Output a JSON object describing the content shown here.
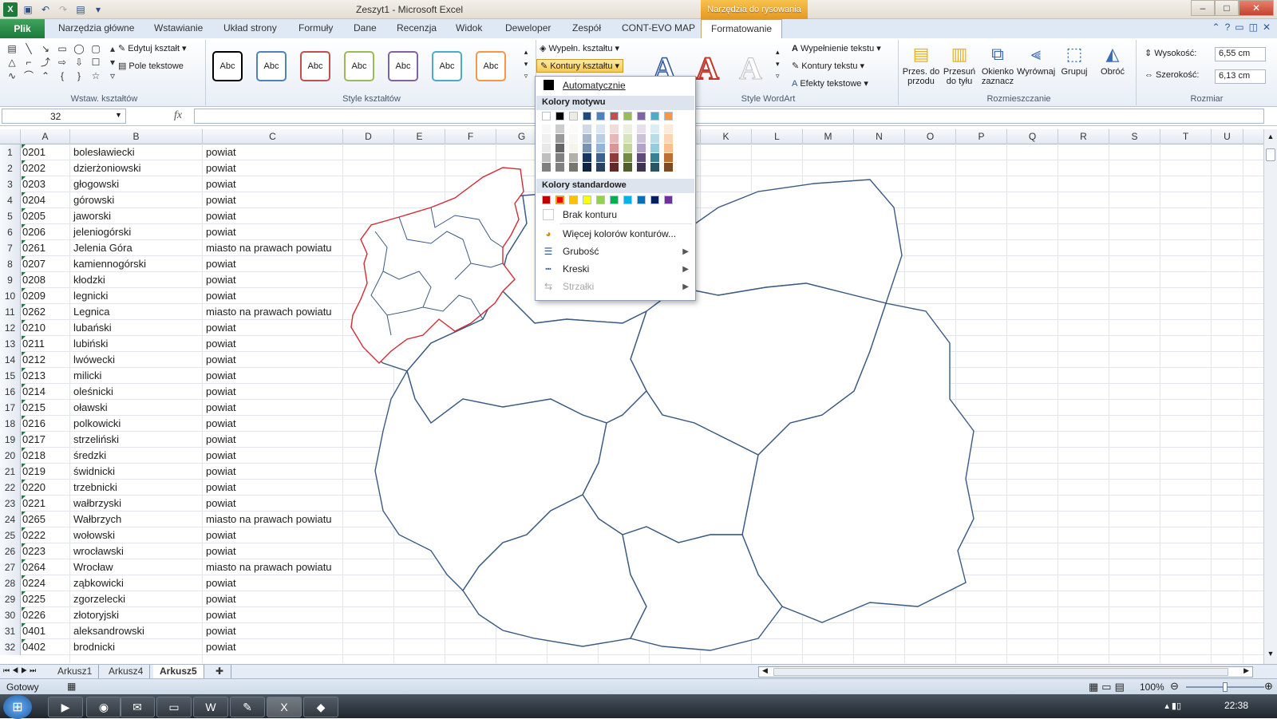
{
  "window": {
    "title": "Zeszyt1  -  Microsoft Excel",
    "context_header": "Narzędzia do rysowania"
  },
  "tabs": [
    "Plik",
    "Narzędzia główne",
    "Wstawianie",
    "Układ strony",
    "Formuły",
    "Dane",
    "Recenzja",
    "Widok",
    "Deweloper",
    "Zespół",
    "CONT-EVO MAP",
    "Formatowanie"
  ],
  "ribbon": {
    "insert_shapes": {
      "label": "Wstaw. kształtów",
      "edit_shape": "Edytuj kształt",
      "text_box": "Pole tekstowe"
    },
    "shape_styles": {
      "label": "Style kształtów",
      "sample": "Abc",
      "fill": "Wypełn. kształtu",
      "outline": "Kontury kształtu"
    },
    "wordart": {
      "label": "Style WordArt",
      "letter": "A",
      "text_fill": "Wypełnienie tekstu",
      "text_outline": "Kontury tekstu",
      "text_effects": "Efekty tekstowe"
    },
    "arrange": {
      "label": "Rozmieszczanie",
      "bring_forward": "Przes. do przodu",
      "send_backward": "Przesuń do tyłu",
      "selection_pane": "Okienko zaznacz",
      "align": "Wyrównaj",
      "group": "Grupuj",
      "rotate": "Obróć"
    },
    "size": {
      "label": "Rozmiar",
      "height_label": "Wysokość:",
      "height": "6,55 cm",
      "width_label": "Szerokość:",
      "width": "6,13 cm"
    }
  },
  "formula_bar": {
    "name_box": "32",
    "fx": "fx",
    "formula": ""
  },
  "columns": [
    "A",
    "B",
    "C",
    "D",
    "E",
    "F",
    "G",
    "H",
    "I",
    "J",
    "K",
    "L",
    "M",
    "N",
    "O",
    "P",
    "Q",
    "R",
    "S",
    "T",
    "U"
  ],
  "rows": [
    {
      "n": "1",
      "a": "0201",
      "b": "bolesławiecki",
      "c": "powiat"
    },
    {
      "n": "2",
      "a": "0202",
      "b": "dzierżoniowski",
      "c": "powiat"
    },
    {
      "n": "3",
      "a": "0203",
      "b": "głogowski",
      "c": "powiat"
    },
    {
      "n": "4",
      "a": "0204",
      "b": "górowski",
      "c": "powiat"
    },
    {
      "n": "5",
      "a": "0205",
      "b": "jaworski",
      "c": "powiat"
    },
    {
      "n": "6",
      "a": "0206",
      "b": "jeleniogórski",
      "c": "powiat"
    },
    {
      "n": "7",
      "a": "0261",
      "b": "Jelenia Góra",
      "c": "miasto na prawach powiatu"
    },
    {
      "n": "8",
      "a": "0207",
      "b": "kamiennogórski",
      "c": "powiat"
    },
    {
      "n": "9",
      "a": "0208",
      "b": "kłodzki",
      "c": "powiat"
    },
    {
      "n": "10",
      "a": "0209",
      "b": "legnicki",
      "c": "powiat"
    },
    {
      "n": "11",
      "a": "0262",
      "b": "Legnica",
      "c": "miasto na prawach powiatu"
    },
    {
      "n": "12",
      "a": "0210",
      "b": "lubański",
      "c": "powiat"
    },
    {
      "n": "13",
      "a": "0211",
      "b": "lubiński",
      "c": "powiat"
    },
    {
      "n": "14",
      "a": "0212",
      "b": "lwówecki",
      "c": "powiat"
    },
    {
      "n": "15",
      "a": "0213",
      "b": "milicki",
      "c": "powiat"
    },
    {
      "n": "16",
      "a": "0214",
      "b": "oleśnicki",
      "c": "powiat"
    },
    {
      "n": "17",
      "a": "0215",
      "b": "oławski",
      "c": "powiat"
    },
    {
      "n": "18",
      "a": "0216",
      "b": "polkowicki",
      "c": "powiat"
    },
    {
      "n": "19",
      "a": "0217",
      "b": "strzeliński",
      "c": "powiat"
    },
    {
      "n": "20",
      "a": "0218",
      "b": "średzki",
      "c": "powiat"
    },
    {
      "n": "21",
      "a": "0219",
      "b": "świdnicki",
      "c": "powiat"
    },
    {
      "n": "22",
      "a": "0220",
      "b": "trzebnicki",
      "c": "powiat"
    },
    {
      "n": "23",
      "a": "0221",
      "b": "wałbrzyski",
      "c": "powiat"
    },
    {
      "n": "24",
      "a": "0265",
      "b": "Wałbrzych",
      "c": "miasto na prawach powiatu"
    },
    {
      "n": "25",
      "a": "0222",
      "b": "wołowski",
      "c": "powiat"
    },
    {
      "n": "26",
      "a": "0223",
      "b": "wrocławski",
      "c": "powiat"
    },
    {
      "n": "27",
      "a": "0264",
      "b": "Wrocław",
      "c": "miasto na prawach powiatu"
    },
    {
      "n": "28",
      "a": "0224",
      "b": "ząbkowicki",
      "c": "powiat"
    },
    {
      "n": "29",
      "a": "0225",
      "b": "zgorzelecki",
      "c": "powiat"
    },
    {
      "n": "30",
      "a": "0226",
      "b": "złotoryjski",
      "c": "powiat"
    },
    {
      "n": "31",
      "a": "0401",
      "b": "aleksandrowski",
      "c": "powiat"
    },
    {
      "n": "32",
      "a": "0402",
      "b": "brodnicki",
      "c": "powiat"
    }
  ],
  "dropdown": {
    "automatic": "Automatycznie",
    "theme_colors": "Kolory motywu",
    "standard_colors": "Kolory standardowe",
    "no_outline": "Brak konturu",
    "more_colors": "Więcej kolorów konturów...",
    "weight": "Grubość",
    "dashes": "Kreski",
    "arrows": "Strzałki",
    "theme_palette": [
      "#ffffff",
      "#000000",
      "#eeece1",
      "#1f497d",
      "#4f81bd",
      "#c0504d",
      "#9bbb59",
      "#8064a2",
      "#4bacc6",
      "#f79646"
    ],
    "standard_palette": [
      "#c00000",
      "#ff0000",
      "#ffc000",
      "#ffff00",
      "#92d050",
      "#00b050",
      "#00b0f0",
      "#0070c0",
      "#002060",
      "#7030a0"
    ]
  },
  "sheets": [
    "Arkusz1",
    "Arkusz4",
    "Arkusz5"
  ],
  "status": {
    "ready": "Gotowy",
    "zoom": "100%"
  },
  "taskbar": {
    "time": "22:38"
  },
  "map_colors": {
    "outline": "#3a5a82",
    "selected": "#d42a35"
  }
}
